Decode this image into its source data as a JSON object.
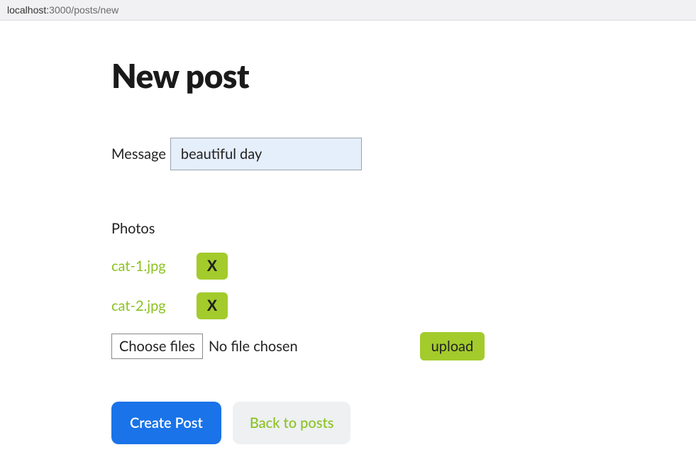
{
  "url": {
    "host": "localhost:",
    "port_path": "3000/posts/new"
  },
  "page": {
    "title": "New post"
  },
  "form": {
    "message_label": "Message",
    "message_value": "beautiful day",
    "photos_label": "Photos",
    "photos": [
      {
        "name": "cat-1.jpg",
        "remove": "X"
      },
      {
        "name": "cat-2.jpg",
        "remove": "X"
      }
    ],
    "choose_files_label": "Choose files",
    "file_status": "No file chosen",
    "upload_label": "upload"
  },
  "actions": {
    "create_label": "Create Post",
    "back_label": "Back to posts"
  }
}
